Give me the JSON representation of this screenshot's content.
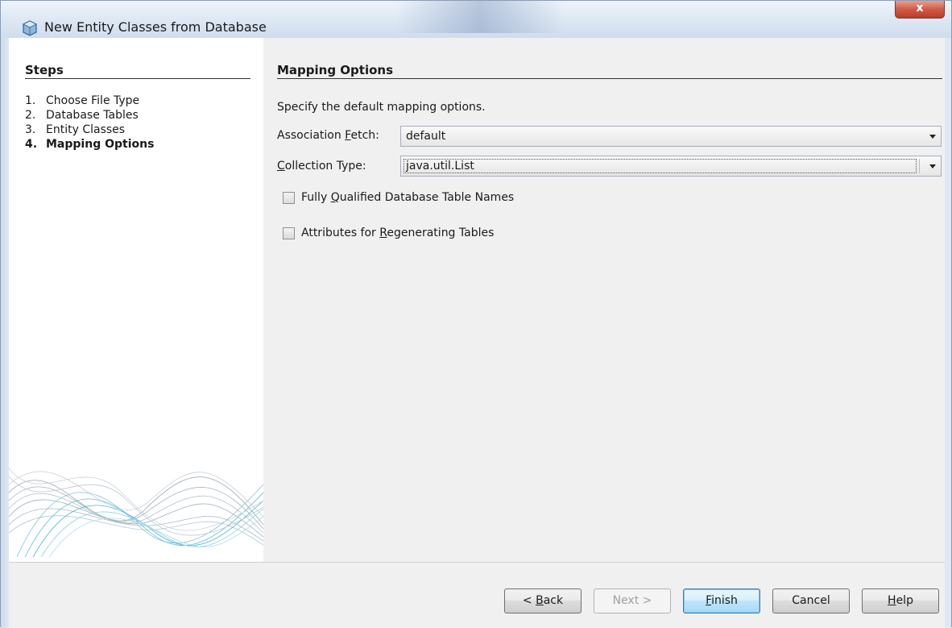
{
  "window": {
    "title": "New Entity Classes from Database",
    "close_glyph": "x",
    "icon": "netbeans-cube-icon"
  },
  "steps": {
    "title": "Steps",
    "items": [
      {
        "num": "1.",
        "label": "Choose File Type",
        "active": false
      },
      {
        "num": "2.",
        "label": "Database Tables",
        "active": false
      },
      {
        "num": "3.",
        "label": "Entity Classes",
        "active": false
      },
      {
        "num": "4.",
        "label": "Mapping Options",
        "active": true
      }
    ]
  },
  "mapping": {
    "title": "Mapping Options",
    "description": "Specify the default mapping options.",
    "association_fetch": {
      "label_pre": "Association ",
      "label_mn": "F",
      "label_post": "etch:",
      "value": "default"
    },
    "collection_type": {
      "label_pre": "",
      "label_mn": "C",
      "label_post": "ollection Type:",
      "value": "java.util.List"
    },
    "checkboxes": [
      {
        "label_pre": "Fully ",
        "label_mn": "Q",
        "label_post": "ualified Database Table Names",
        "checked": false
      },
      {
        "label_pre": "Attributes for ",
        "label_mn": "R",
        "label_post": "egenerating Tables",
        "checked": false
      }
    ]
  },
  "buttons": {
    "back": {
      "pre": "< ",
      "mn": "B",
      "post": "ack"
    },
    "next": {
      "label": "Next >"
    },
    "finish": {
      "pre": "",
      "mn": "F",
      "post": "inish"
    },
    "cancel": {
      "label": "Cancel"
    },
    "help": {
      "pre": "",
      "mn": "H",
      "post": "elp"
    }
  },
  "colors": {
    "accent": "#3c7fb1",
    "close": "#cf5b47"
  }
}
